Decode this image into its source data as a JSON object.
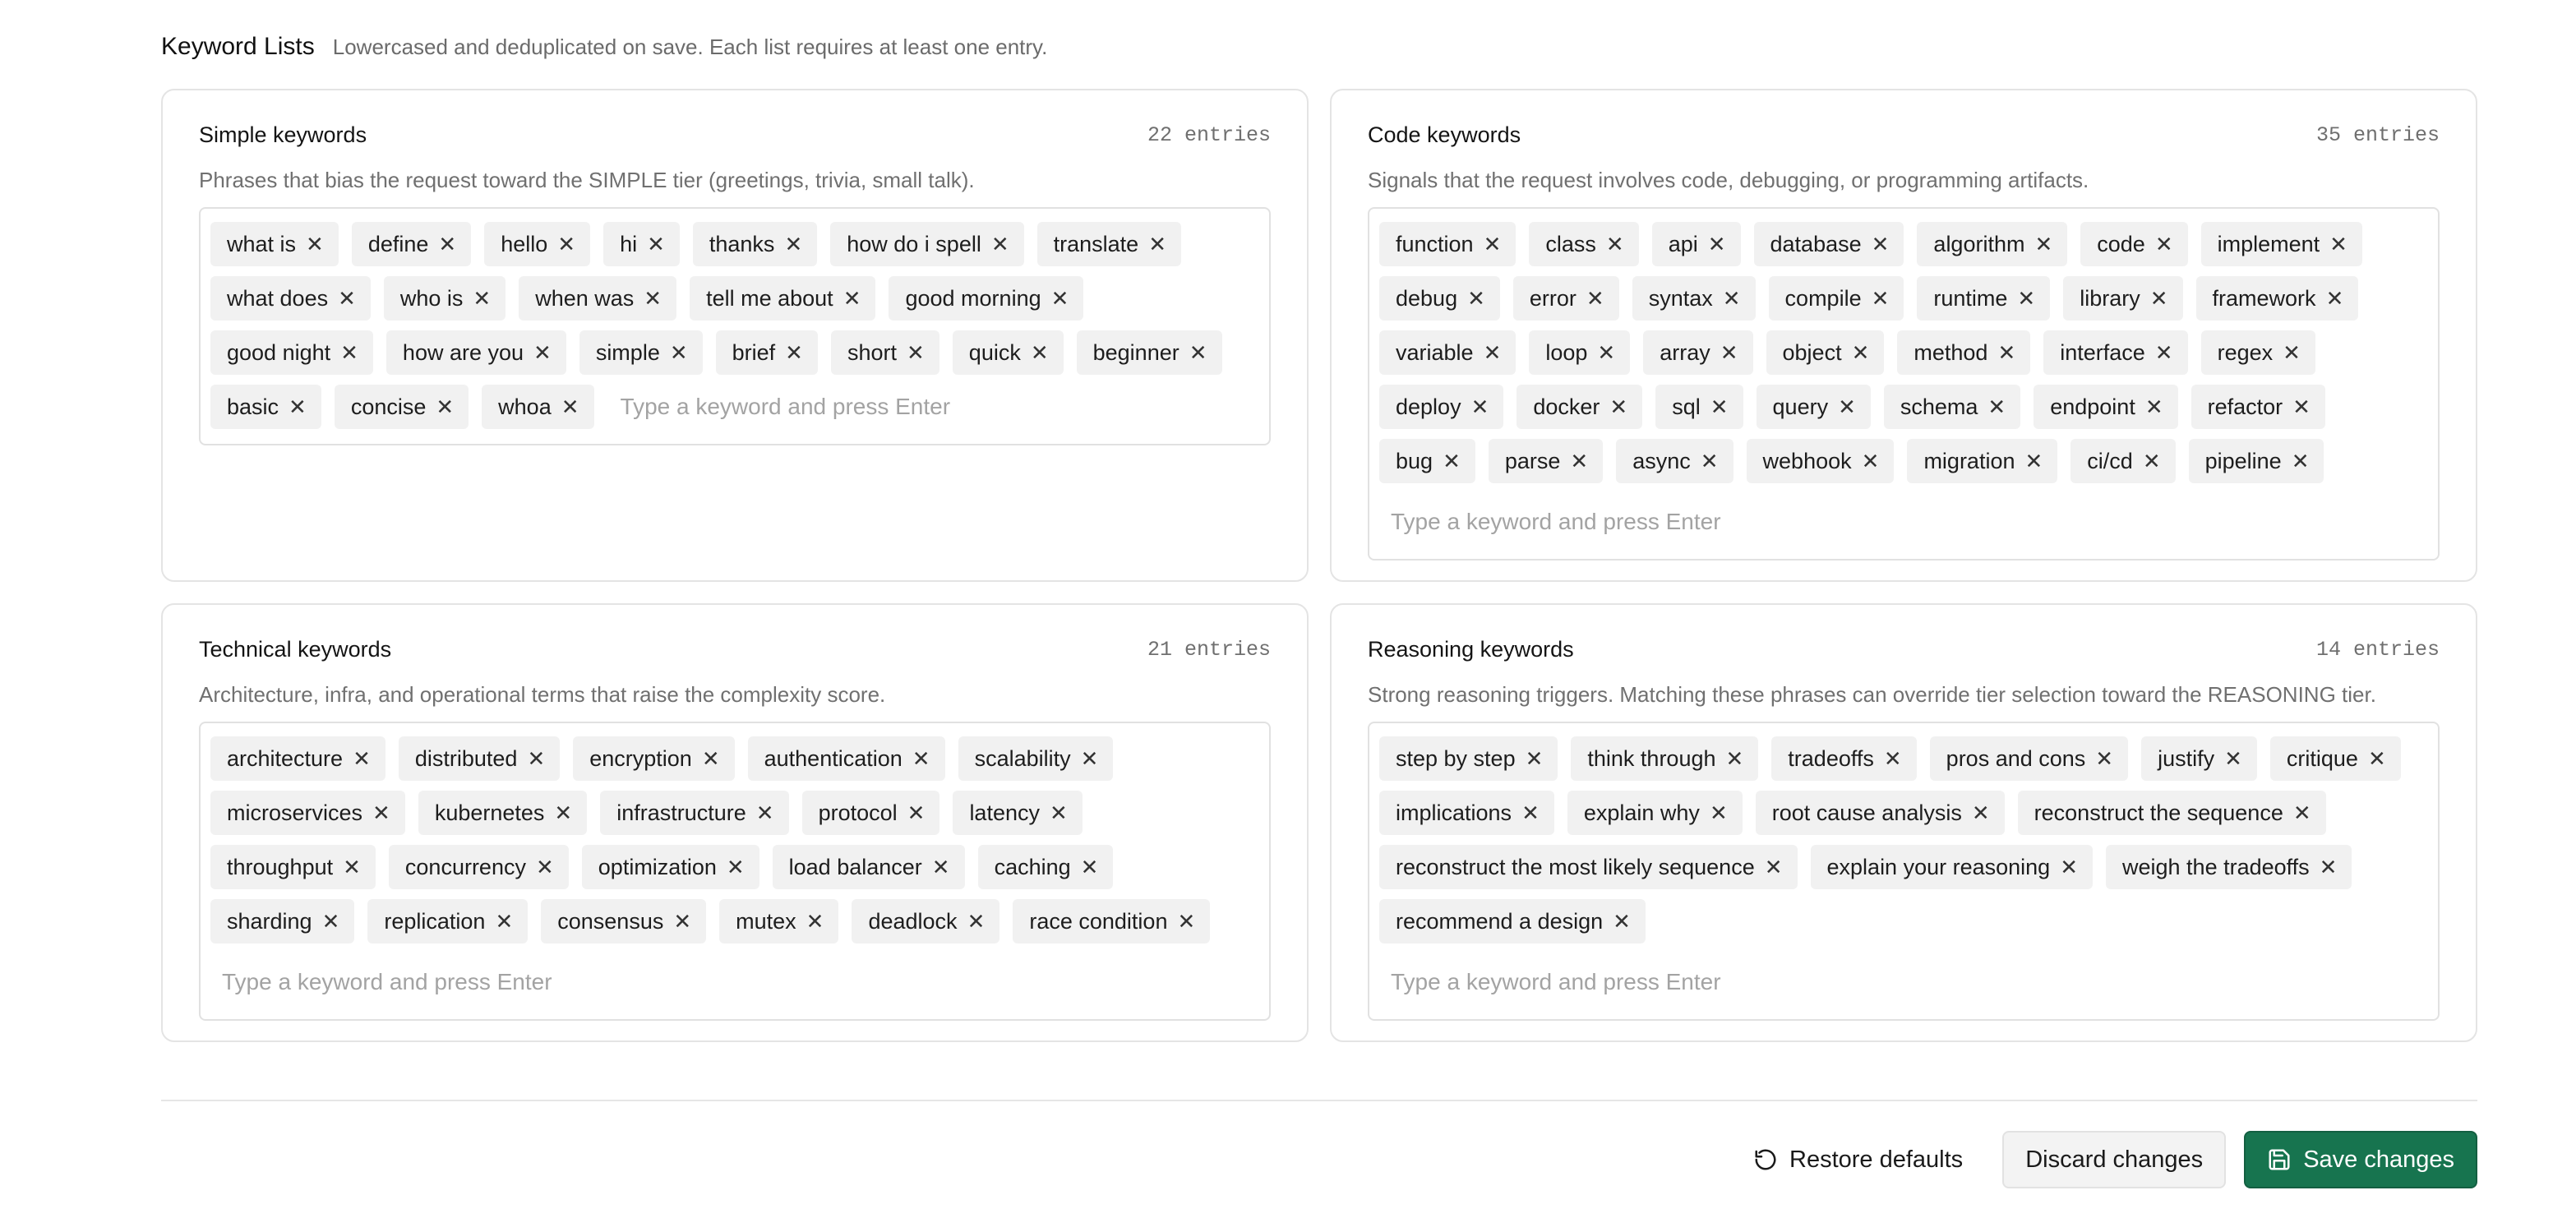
{
  "section": {
    "title": "Keyword Lists",
    "subtitle": "Lowercased and deduplicated on save. Each list requires at least one entry."
  },
  "placeholder": "Type a keyword and press Enter",
  "cards": [
    {
      "id": "simple",
      "title": "Simple keywords",
      "count": "22 entries",
      "description": "Phrases that bias the request toward the SIMPLE tier (greetings, trivia, small talk).",
      "keywords": [
        "what is",
        "define",
        "hello",
        "hi",
        "thanks",
        "how do i spell",
        "translate",
        "what does",
        "who is",
        "when was",
        "tell me about",
        "good morning",
        "good night",
        "how are you",
        "simple",
        "brief",
        "short",
        "quick",
        "beginner",
        "basic",
        "concise",
        "whoa"
      ]
    },
    {
      "id": "code",
      "title": "Code keywords",
      "count": "35 entries",
      "description": "Signals that the request involves code, debugging, or programming artifacts.",
      "keywords": [
        "function",
        "class",
        "api",
        "database",
        "algorithm",
        "code",
        "implement",
        "debug",
        "error",
        "syntax",
        "compile",
        "runtime",
        "library",
        "framework",
        "variable",
        "loop",
        "array",
        "object",
        "method",
        "interface",
        "regex",
        "deploy",
        "docker",
        "sql",
        "query",
        "schema",
        "endpoint",
        "refactor",
        "bug",
        "parse",
        "async",
        "webhook",
        "migration",
        "ci/cd",
        "pipeline"
      ]
    },
    {
      "id": "technical",
      "title": "Technical keywords",
      "count": "21 entries",
      "description": "Architecture, infra, and operational terms that raise the complexity score.",
      "keywords": [
        "architecture",
        "distributed",
        "encryption",
        "authentication",
        "scalability",
        "microservices",
        "kubernetes",
        "infrastructure",
        "protocol",
        "latency",
        "throughput",
        "concurrency",
        "optimization",
        "load balancer",
        "caching",
        "sharding",
        "replication",
        "consensus",
        "mutex",
        "deadlock",
        "race condition"
      ]
    },
    {
      "id": "reasoning",
      "title": "Reasoning keywords",
      "count": "14 entries",
      "description": "Strong reasoning triggers. Matching these phrases can override tier selection toward the REASONING tier.",
      "keywords": [
        "step by step",
        "think through",
        "tradeoffs",
        "pros and cons",
        "justify",
        "critique",
        "implications",
        "explain why",
        "root cause analysis",
        "reconstruct the sequence",
        "reconstruct the most likely sequence",
        "explain your reasoning",
        "weigh the tradeoffs",
        "recommend a design"
      ]
    }
  ],
  "footer": {
    "restore_label": "Restore defaults",
    "discard_label": "Discard changes",
    "save_label": "Save changes"
  },
  "colors": {
    "primary": "#17744f",
    "tag_bg": "#f1f1f1",
    "border": "#e4e4e4"
  }
}
